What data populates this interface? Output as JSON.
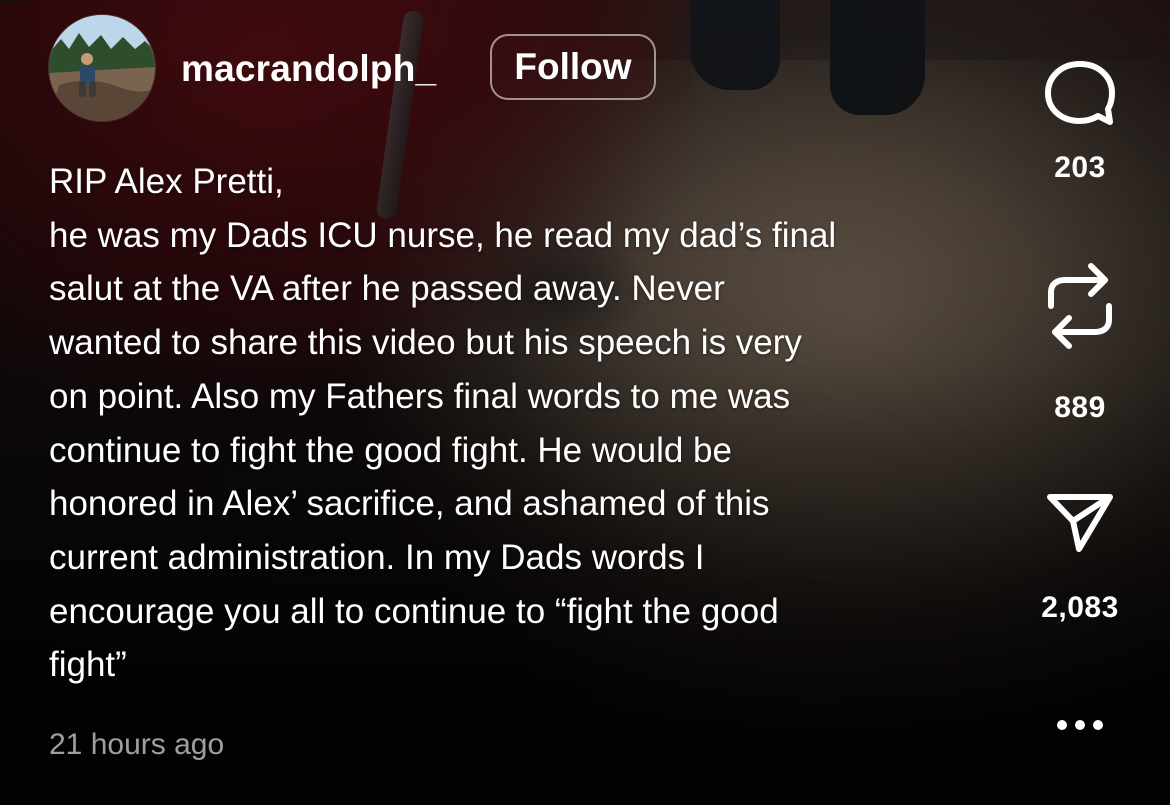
{
  "post": {
    "username": "macrandolph_",
    "follow_label": "Follow",
    "caption": "RIP Alex Pretti,\nhe was my Dads ICU nurse, he read my dad’s final\nsalut at the VA after he passed away. Never\nwanted to share this video but his speech is very\non point. Also my Fathers final words to me was\ncontinue to fight the good fight. He would be\nhonored in Alex’ sacrifice, and ashamed of this\ncurrent administration. In my Dads words I\nencourage you all to continue to “fight the good\nfight”",
    "timestamp": "21 hours ago"
  },
  "actions": {
    "comments": {
      "icon": "comment-bubble-icon",
      "count": "203"
    },
    "reposts": {
      "icon": "repost-arrows-icon",
      "count": "889"
    },
    "shares": {
      "icon": "send-paper-plane-icon",
      "count": "2,083"
    },
    "more": {
      "icon": "more-dots-icon"
    }
  },
  "colors": {
    "text": "#ffffff",
    "muted_text": "#a8a4a2",
    "follow_border": "#9a8f90"
  }
}
